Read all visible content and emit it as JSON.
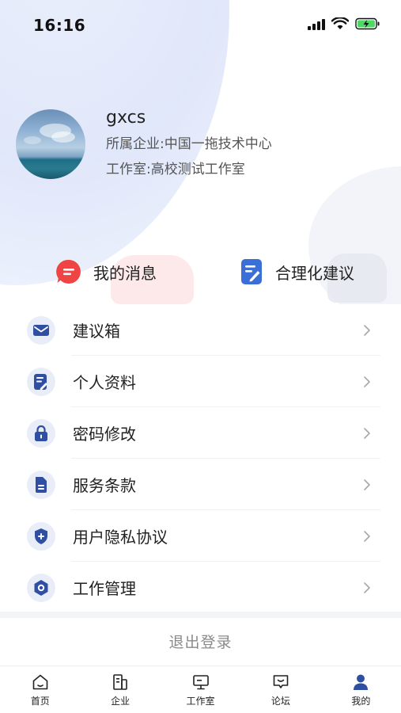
{
  "status_bar": {
    "time": "16:16"
  },
  "profile": {
    "username": "gxcs",
    "company": "所属企业:中国一拖技术中心",
    "studio": "工作室:高校测试工作室"
  },
  "quick_actions": [
    {
      "label": "我的消息",
      "icon": "message-icon",
      "color": "#ef4444"
    },
    {
      "label": "合理化建议",
      "icon": "edit-note-icon",
      "color": "#3b6fd8"
    }
  ],
  "menu": [
    {
      "label": "建议箱",
      "icon": "mail-icon"
    },
    {
      "label": "个人资料",
      "icon": "profile-doc-icon"
    },
    {
      "label": "密码修改",
      "icon": "lock-icon"
    },
    {
      "label": "服务条款",
      "icon": "document-icon"
    },
    {
      "label": "用户隐私协议",
      "icon": "shield-icon"
    },
    {
      "label": "工作管理",
      "icon": "hexagon-gear-icon"
    }
  ],
  "logout_label": "退出登录",
  "tabbar": [
    {
      "label": "首页",
      "icon": "home-icon",
      "active": false
    },
    {
      "label": "企业",
      "icon": "building-icon",
      "active": false
    },
    {
      "label": "工作室",
      "icon": "monitor-icon",
      "active": false
    },
    {
      "label": "论坛",
      "icon": "forum-icon",
      "active": false
    },
    {
      "label": "我的",
      "icon": "user-icon",
      "active": true
    }
  ],
  "colors": {
    "accent": "#2f4fa3",
    "menu_icon_bg": "#e8edf8",
    "message_red": "#ef4444",
    "suggest_blue": "#3b6fd8",
    "battery_green": "#4cd964"
  }
}
